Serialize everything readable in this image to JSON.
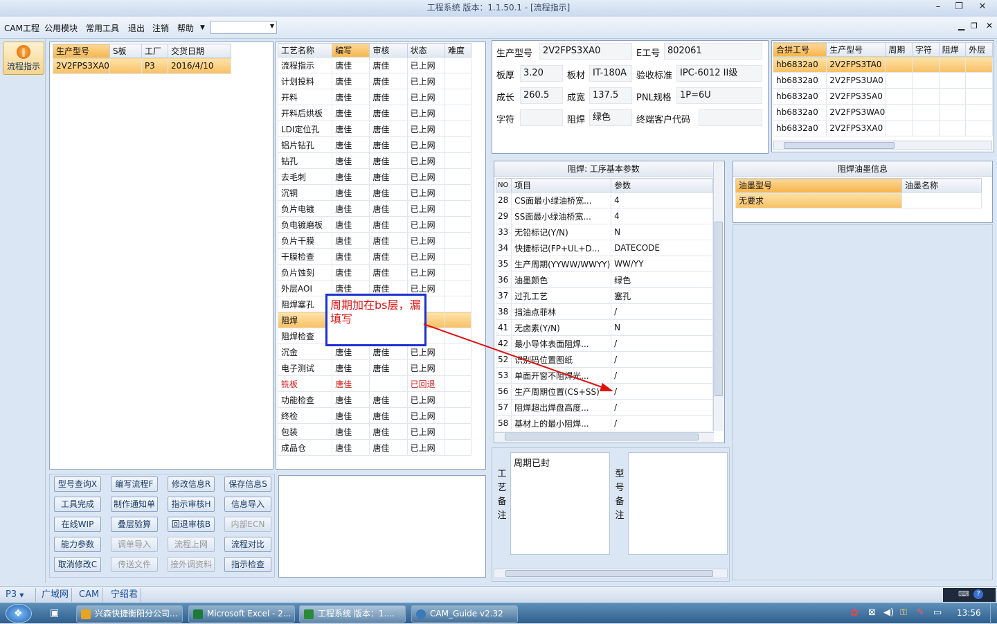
{
  "window": {
    "title": "工程系统   版本：1.1.50.1 - [流程指示]"
  },
  "menu": [
    "CAM工程",
    "公用模块",
    "常用工具",
    "退出",
    "注销",
    "帮助"
  ],
  "left_button": {
    "label": "流程指示"
  },
  "orders": {
    "headers": [
      "生产型号",
      "S板",
      "工厂",
      "交货日期"
    ],
    "rows": [
      [
        "2V2FPS3XA0",
        "",
        "P3",
        "2016/4/10"
      ]
    ]
  },
  "process": {
    "headers": [
      "工艺名称",
      "编写",
      "审核",
      "状态",
      "难度"
    ],
    "rows": [
      [
        "流程指示",
        "唐佳",
        "唐佳",
        "已上网",
        ""
      ],
      [
        "计划投料",
        "唐佳",
        "唐佳",
        "已上网",
        ""
      ],
      [
        "开料",
        "唐佳",
        "唐佳",
        "已上网",
        ""
      ],
      [
        "开料后烘板",
        "唐佳",
        "唐佳",
        "已上网",
        ""
      ],
      [
        "LDI定位孔",
        "唐佳",
        "唐佳",
        "已上网",
        ""
      ],
      [
        "铝片钻孔",
        "唐佳",
        "唐佳",
        "已上网",
        ""
      ],
      [
        "钻孔",
        "唐佳",
        "唐佳",
        "已上网",
        ""
      ],
      [
        "去毛刺",
        "唐佳",
        "唐佳",
        "已上网",
        ""
      ],
      [
        "沉铜",
        "唐佳",
        "唐佳",
        "已上网",
        ""
      ],
      [
        "负片电镀",
        "唐佳",
        "唐佳",
        "已上网",
        ""
      ],
      [
        "负电镀磨板",
        "唐佳",
        "唐佳",
        "已上网",
        ""
      ],
      [
        "负片干膜",
        "唐佳",
        "唐佳",
        "已上网",
        ""
      ],
      [
        "干膜检查",
        "唐佳",
        "唐佳",
        "已上网",
        ""
      ],
      [
        "负片蚀刻",
        "唐佳",
        "唐佳",
        "已上网",
        ""
      ],
      [
        "外层AOI",
        "唐佳",
        "唐佳",
        "已上网",
        ""
      ],
      [
        "阻焊塞孔",
        "",
        "",
        "网",
        ""
      ],
      [
        "阻焊",
        "",
        "",
        "网",
        ""
      ],
      [
        "阻焊检查",
        "",
        "",
        "网",
        ""
      ],
      [
        "沉金",
        "唐佳",
        "唐佳",
        "已上网",
        ""
      ],
      [
        "电子测试",
        "唐佳",
        "唐佳",
        "已上网",
        ""
      ],
      [
        "铣板",
        "唐佳",
        "",
        "已回退",
        ""
      ],
      [
        "功能检查",
        "唐佳",
        "唐佳",
        "已上网",
        ""
      ],
      [
        "终检",
        "唐佳",
        "唐佳",
        "已上网",
        ""
      ],
      [
        "包装",
        "唐佳",
        "唐佳",
        "已上网",
        ""
      ],
      [
        "成品仓",
        "唐佳",
        "唐佳",
        "已上网",
        ""
      ]
    ]
  },
  "info": {
    "model_label": "生产型号",
    "model": "2V2FPS3XA0",
    "e_label": "E工号",
    "e_no": "802061",
    "thick_label": "板厚",
    "thick": "3.20",
    "mat_label": "板材",
    "mat": "IT-180A",
    "std_label": "验收标准",
    "std": "IPC-6012 II级",
    "len_label": "成长",
    "len": "260.5",
    "wid_label": "成宽",
    "wid": "137.5",
    "pnl_label": "PNL规格",
    "pnl": "1P=6U",
    "char_label": "字符",
    "char": "",
    "mask_label": "阻焊",
    "mask": "绿色",
    "cust_label": "终端客户代码",
    "cust": ""
  },
  "combine": {
    "headers": [
      "合拼工号",
      "生产型号",
      "周期",
      "字符",
      "阻焊",
      "外层"
    ],
    "rows": [
      [
        "hb6832a0",
        "2V2FPS3TA0",
        "",
        "",
        "",
        ""
      ],
      [
        "hb6832a0",
        "2V2FPS3UA0",
        "",
        "",
        "",
        ""
      ],
      [
        "hb6832a0",
        "2V2FPS3SA0",
        "",
        "",
        "",
        ""
      ],
      [
        "hb6832a0",
        "2V2FPS3WA0",
        "",
        "",
        "",
        ""
      ],
      [
        "hb6832a0",
        "2V2FPS3XA0",
        "",
        "",
        "",
        ""
      ]
    ]
  },
  "params": {
    "title": "阻焊: 工序基本参数",
    "headers": [
      "NO",
      "项目",
      "参数"
    ],
    "rows": [
      [
        "28",
        "CS面最小绿油桥宽...",
        "4"
      ],
      [
        "29",
        "SS面最小绿油桥宽...",
        "4"
      ],
      [
        "33",
        "无铅标记(Y/N)",
        "N"
      ],
      [
        "34",
        "快捷标记(FP+UL+D...",
        "DATECODE"
      ],
      [
        "35",
        "生产周期(YYWW/WWYY)",
        "WW/YY"
      ],
      [
        "36",
        "油墨颜色",
        "绿色"
      ],
      [
        "37",
        "过孔工艺",
        "塞孔"
      ],
      [
        "38",
        "挡油点菲林",
        "/"
      ],
      [
        "41",
        "无卤素(Y/N)",
        "N"
      ],
      [
        "42",
        "最小导体表面阻焊...",
        "/"
      ],
      [
        "52",
        "识别码位置图纸",
        "/"
      ],
      [
        "53",
        "单面开窗不阻焊光...",
        "/"
      ],
      [
        "56",
        "生产周期位置(CS+SS)",
        "/"
      ],
      [
        "57",
        "阻焊超出焊盘高度...",
        "/"
      ],
      [
        "58",
        "基材上的最小阻焊...",
        "/"
      ]
    ]
  },
  "ink": {
    "title": "阻焊油墨信息",
    "headers": [
      "油墨型号",
      "油墨名称"
    ],
    "rows": [
      [
        "无要求",
        ""
      ]
    ]
  },
  "remarks": {
    "process_label": "工艺备注",
    "process_text": "周期已封",
    "model_label": "型号备注",
    "model_text": ""
  },
  "annotation": {
    "text": "周期加在bs层，漏填写"
  },
  "buttons": [
    [
      "型号查询X",
      "编写流程F",
      "修改信息R",
      "保存信息S"
    ],
    [
      "工具完成",
      "制作通知单",
      "指示审核H",
      "信息导入"
    ],
    [
      "在线WIP",
      "叠层验算",
      "回退审核B",
      "内部ECN"
    ],
    [
      "能力参数",
      "调单导入",
      "流程上网",
      "流程对比"
    ],
    [
      "取消修改C",
      "传送文件",
      "接外调资料",
      "指示检查"
    ]
  ],
  "disabled_buttons": [
    "内部ECN",
    "调单导入",
    "流程上网",
    "传送文件",
    "接外调资料"
  ],
  "statusbar": {
    "site": "P3",
    "tabs": [
      "广域网",
      "CAM",
      "宁绍君"
    ]
  },
  "taskbar": {
    "items": [
      "兴森快捷衡阳分公司...",
      "Microsoft Excel - 2...",
      "工程系统   版本：1....",
      "CAM_Guide v2.32"
    ],
    "clock": "13:56"
  }
}
